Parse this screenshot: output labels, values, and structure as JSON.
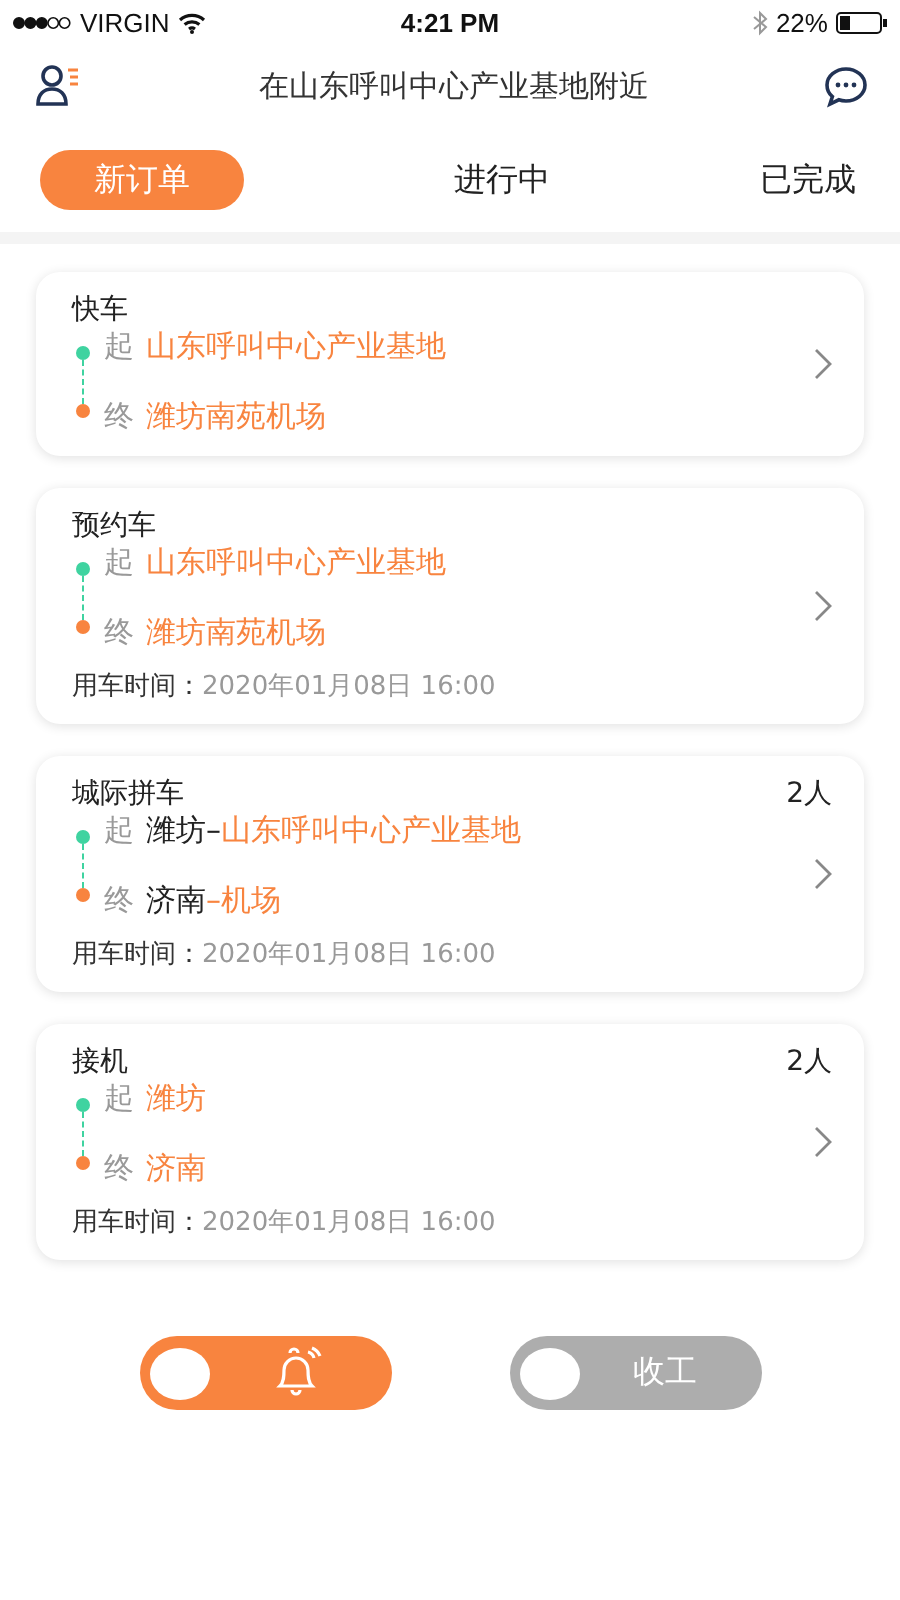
{
  "status_bar": {
    "carrier": "VIRGIN",
    "time": "4:21 PM",
    "battery": "22%"
  },
  "header": {
    "title": "在山东呼叫中心产业基地附近"
  },
  "tabs": [
    {
      "label": "新订单",
      "selected": true
    },
    {
      "label": "进行中",
      "selected": false
    },
    {
      "label": "已完成",
      "selected": false
    }
  ],
  "orders": [
    {
      "type": "快车",
      "from_label": "起",
      "from": [
        {
          "text": "山东呼叫中心产业基地",
          "accent": true
        }
      ],
      "to_label": "终",
      "to": [
        {
          "text": "潍坊南苑机场",
          "accent": true
        }
      ]
    },
    {
      "type": "预约车",
      "from_label": "起",
      "from": [
        {
          "text": "山东呼叫中心产业基地",
          "accent": true
        }
      ],
      "to_label": "终",
      "to": [
        {
          "text": "潍坊南苑机场",
          "accent": true
        }
      ],
      "time_label": "用车时间：",
      "time": "2020年01月08日 16:00"
    },
    {
      "type": "城际拼车",
      "passengers": "2人",
      "from_label": "起",
      "from": [
        {
          "text": "潍坊–",
          "accent": false
        },
        {
          "text": "山东呼叫中心产业基地",
          "accent": true
        }
      ],
      "to_label": "终",
      "to": [
        {
          "text": "济南",
          "accent": false
        },
        {
          "text": "–机场",
          "accent": true
        }
      ],
      "time_label": "用车时间：",
      "time": "2020年01月08日 16:00"
    },
    {
      "type": "接机",
      "passengers": "2人",
      "from_label": "起",
      "from": [
        {
          "text": "潍坊",
          "accent": true
        }
      ],
      "to_label": "终",
      "to": [
        {
          "text": "济南",
          "accent": true
        }
      ],
      "time_label": "用车时间：",
      "time": "2020年01月08日 16:00"
    }
  ],
  "toggles": [
    {
      "kind": "bell",
      "on": true
    },
    {
      "kind": "text",
      "label": "收工",
      "on": false
    }
  ]
}
